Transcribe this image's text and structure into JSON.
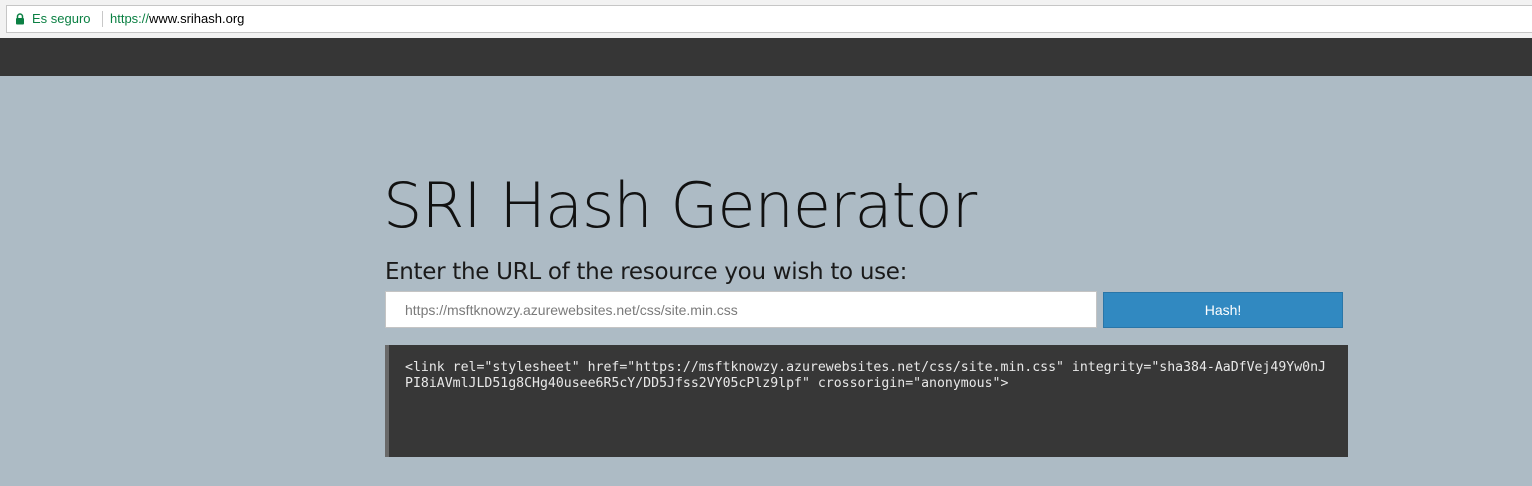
{
  "browser": {
    "security_label": "Es seguro",
    "url_scheme": "https://",
    "url_host": "www.srihash.org",
    "lock_color": "#0b8043"
  },
  "main": {
    "title": "SRI Hash Generator",
    "prompt": "Enter the URL of the resource you wish to use:",
    "url_input_value": "https://msftknowzy.azurewebsites.net/css/site.min.css",
    "hash_button_label": "Hash!",
    "output": "<link rel=\"stylesheet\" href=\"https://msftknowzy.azurewebsites.net/css/site.min.css\" integrity=\"sha384-AaDfVej49Yw0nJPI8iAVmlJLD51g8CHg40usee6R5cY/DD5Jfss2VY05cPlz9lpf\" crossorigin=\"anonymous\">"
  },
  "colors": {
    "background": "#adbbc5",
    "navbar": "#363636",
    "button": "#3189c1",
    "output_background": "#373737"
  }
}
